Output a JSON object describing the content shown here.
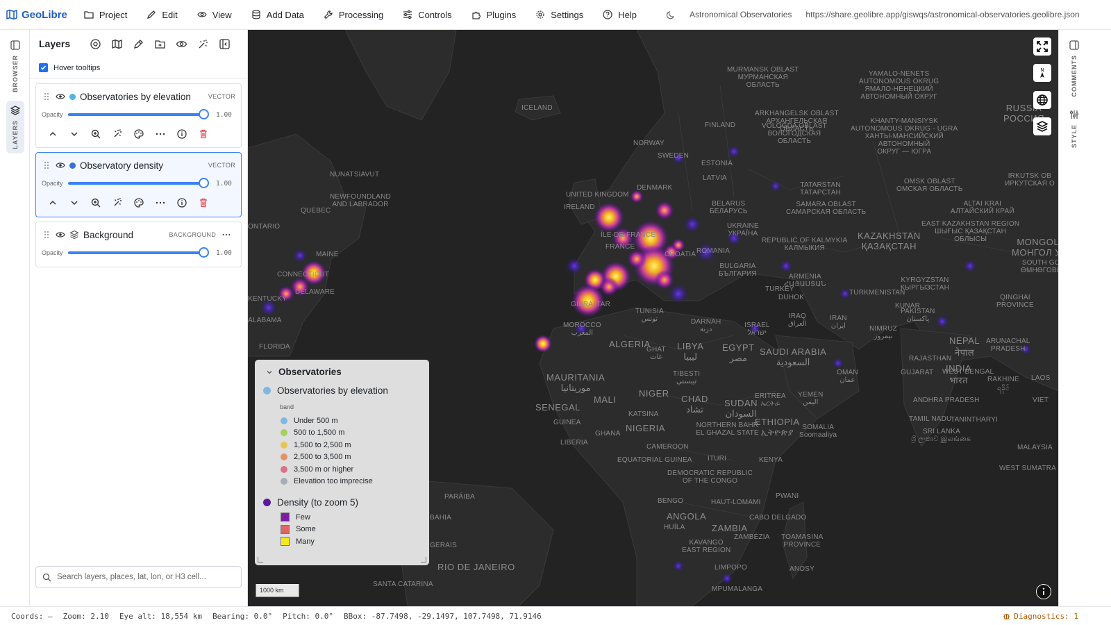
{
  "app": {
    "name": "GeoLibre"
  },
  "menu": [
    {
      "label": "Project",
      "icon": "folder-icon"
    },
    {
      "label": "Edit",
      "icon": "pencil-icon"
    },
    {
      "label": "View",
      "icon": "eye-icon"
    },
    {
      "label": "Add Data",
      "icon": "database-icon"
    },
    {
      "label": "Processing",
      "icon": "wrench-icon"
    },
    {
      "label": "Controls",
      "icon": "sliders-icon"
    },
    {
      "label": "Plugins",
      "icon": "puzzle-icon"
    },
    {
      "label": "Settings",
      "icon": "gear-icon"
    },
    {
      "label": "Help",
      "icon": "help-circle-icon"
    }
  ],
  "project": {
    "title": "Astronomical Observatories",
    "url": "https://share.geolibre.app/giswqs/astronomical-observatories.geolibre.json"
  },
  "rail_left": {
    "browser": "BROWSER",
    "layers": "LAYERS"
  },
  "rail_right": {
    "comments": "COMMENTS",
    "style": "STYLE"
  },
  "panel": {
    "title": "Layers",
    "hover_tooltips": "Hover tooltips",
    "opacity_label": "Opacity",
    "search_placeholder": "Search layers, places, lat, lon, or H3 cell..."
  },
  "layers": [
    {
      "name": "Observatories by elevation",
      "type": "VECTOR",
      "opacity": "1.00",
      "opacity_value": 1.0,
      "color": "#4fb3e6"
    },
    {
      "name": "Observatory density",
      "type": "VECTOR",
      "opacity": "1.00",
      "opacity_value": 1.0,
      "color": "#3b6fd6"
    },
    {
      "name": "Background",
      "type": "BACKGROUND",
      "opacity": "1.00",
      "opacity_value": 1.0
    }
  ],
  "legend": {
    "title": "Observatories",
    "elevation": {
      "title": "Observatories by elevation",
      "sub": "band",
      "items": [
        {
          "label": "Under 500 m",
          "color": "#7fb8e0"
        },
        {
          "label": "500 to 1,500 m",
          "color": "#a6cf5c"
        },
        {
          "label": "1,500 to 2,500 m",
          "color": "#e8c452"
        },
        {
          "label": "2,500 to 3,500 m",
          "color": "#e39268"
        },
        {
          "label": "3,500 m or higher",
          "color": "#de7185"
        },
        {
          "label": "Elevation too imprecise",
          "color": "#a8adb8"
        }
      ]
    },
    "density": {
      "title": "Density (to zoom 5)",
      "items": [
        {
          "label": "Few",
          "color": "#7a1fa2"
        },
        {
          "label": "Some",
          "color": "#e06666"
        },
        {
          "label": "Many",
          "color": "#f2ea1e"
        }
      ]
    }
  },
  "map": {
    "scale": "1000 km",
    "labels": [
      "MURMANSK OBLAST",
      "МУРМАНСКАЯ",
      "ОБЛАСТЬ",
      "YAMALO-NENETS",
      "AUTONOMOUS OKRUG",
      "ЯМАЛО-НЕНЕЦКИЙ",
      "АВТОНОМНЫЙ ОКРУГ",
      "ICELAND",
      "FINLAND",
      "NORWAY",
      "SWEDEN",
      "ESTONIA",
      "LATVIA",
      "DENMARK",
      "ARKHANGELSK OBLAST",
      "АРХАНГЕЛЬСКАЯ",
      "ОБЛАСТЬ",
      "KHANTY-MANSIYSK",
      "AUTONOMOUS OKRUG - UGRA",
      "ХАНТЫ-МАНСИЙСКИЙ",
      "АВТОНОМНЫЙ",
      "ОКРУГ — ЮГРА",
      "VOLOGDA OBLAST",
      "ВОЛОГОДСКАЯ",
      "ОБЛАСТЬ",
      "RUSSIA",
      "РОССИЯ",
      "NUNATSIAVUT",
      "NEWFOUNDLAND",
      "AND LABRADOR",
      "QUEBEC",
      "ONTARIO",
      "MAINE",
      "UNITED KINGDOM",
      "IRELAND",
      "BELARUS",
      "БЕЛАРУСЬ",
      "UKRAINE",
      "УКРАЇНА",
      "TATARSTAN",
      "ТАТАРСТАН",
      "SAMARA OBLAST",
      "САМАРСКАЯ ОБЛАСТЬ",
      "OMSK OBLAST",
      "ОМСКАЯ ОБЛАСТЬ",
      "IRKUTSK OB",
      "ИРКУТСКАЯ О",
      "ALTAI KRAI",
      "АЛТАЙСКИЙ КРАЙ",
      "EAST KAZAKHSTAN REGION",
      "ШЫҒЫС ҚАЗАҚСТАН",
      "ОБЛЫСЫ",
      "KAZAKHSTAN",
      "ҚАЗАҚСТАН",
      "REPUBLIC OF KALMYKIA",
      "КАЛМЫКИЯ",
      "MONGOLI",
      "МОНГОЛ УЛ",
      "SOUTH GO",
      "ӨМНӨГОВЬ",
      "ÎLE-DE-FRANCE",
      "FRANCE",
      "CROATIA",
      "ROMANIA",
      "BULGARIA",
      "БЪЛГАРИЯ",
      "CONNECTICUT",
      "DELAWARE",
      "KENTUCKY",
      "ALABAMA",
      "FLORIDA",
      "TURKEY",
      "ARMENIA",
      "ՀԱՅԱՍՏԱՆ",
      "DUHOK",
      "TURKMENISTAN",
      "KYRGYZSTAN",
      "КЫРГЫЗСТАН",
      "QINGHAI",
      "PROVINCE",
      "GIBRALTAR",
      "TUNISIA",
      "تونس",
      "MOROCCO",
      "المغرب",
      "DARNAH",
      "درنة",
      "ISRAEL",
      "ישראל",
      "IRAQ",
      "العراق",
      "IRAN",
      "ایران",
      "NIMRUZ",
      "نیمروز",
      "KUNAR",
      "PAKISTAN",
      "پاکستان",
      "ALGERIA",
      "LIBYA",
      "ليبيا",
      "EGYPT",
      "مصر",
      "GHAT",
      "غات",
      "SAUDI ARABIA",
      "السعودية",
      "NEPAL",
      "नेपाल",
      "ARUNACHAL",
      "PRADESH",
      "RAJASTHAN",
      "MAURITANIA",
      "موريتانيا",
      "TIBESTI",
      "تيبستي",
      "OMAN",
      "عمان",
      "INDIA",
      "भारत",
      "GUJARAT",
      "WEST BENGAL",
      "LAOS",
      "RAKHINE",
      "ရခိုင်",
      "SENEGAL",
      "MALI",
      "NIGER",
      "CHAD",
      "تشاد",
      "SUDAN",
      "السودان",
      "ERITREA",
      "ኤርትራ",
      "YEMEN",
      "اليمن",
      "ANDHRA PRADESH",
      "VIET",
      "GUINEA",
      "KATSINA",
      "NIGERIA",
      "ETHIOPIA",
      "ኢትዮጵያ",
      "TAMIL NADU",
      "TANINTHARYI",
      "LIBERIA",
      "GHANA",
      "CAMEROON",
      "NORTHERN BAHR",
      "EL GHAZAL STATE",
      "SOMALIA",
      "Soomaaliya",
      "SRI LANKA",
      "ශ්‍රී ලංකාව இலங்கை",
      "MALAYSIA",
      "EQUATORIAL GUINEA",
      "ITURI",
      "KENYA",
      "DEMOCRATIC REPUBLIC",
      "OF THE CONGO",
      "WEST SUMATRA",
      "BENGO",
      "HAUT-LOMAMI",
      "PWANI",
      "ANGOLA",
      "CABO DELGADO",
      "HUÍLA",
      "ZAMBIA",
      "ZAMBÉZIA",
      "KAVANGO",
      "EAST REGION",
      "TOAMASINA",
      "PROVINCE",
      "PARÁIBA",
      "BAHIA",
      "GERAIS",
      "RIO DE JANEIRO",
      "SANTA CATARINA",
      "LIMPOPO",
      "ANOSY",
      "MPUMALANGA"
    ]
  },
  "status": {
    "coords": "Coords: —",
    "zoom": "Zoom: 2.10",
    "eye_alt": "Eye alt: 18,554 km",
    "bearing": "Bearing: 0.0°",
    "pitch": "Pitch: 0.0°",
    "bbox": "BBox: -87.7498, -29.1497, 107.7498, 71.9146",
    "diagnostics": "Diagnostics: 1"
  }
}
